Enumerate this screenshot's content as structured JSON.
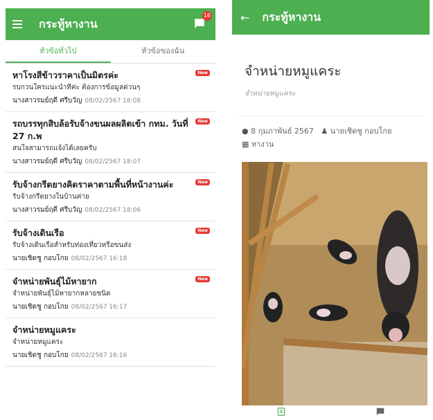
{
  "app": {
    "title": "กระทู้หางาน",
    "notification_count": "16"
  },
  "tabs": [
    {
      "label": "หัวข้อทั่วไป",
      "active": true
    },
    {
      "label": "หัวข้อของฉัน",
      "active": false
    }
  ],
  "posts": [
    {
      "title": "หาโรงสีข้าวราคาเป็นมิตรค่ะ",
      "subtitle": "รบกวนใครแนะนำทีค่ะ ต้องการข้อมูลด่วนๆ",
      "author": "นางสาวรมย์ฤดี ศรีบวัญ",
      "date": "08/02/2567 18:08",
      "new_badge": "New"
    },
    {
      "title": "รถบรรทุกสิบล้อรับจ้างขนผลผลิตเข้า กทม. วันที่ 27 ก.พ",
      "subtitle": "สนใจสามารถแจ้งได้เลยครับ",
      "author": "นางสาวรมย์ฤดี ศรีบวัญ",
      "date": "08/02/2567 18:07",
      "new_badge": "New"
    },
    {
      "title": "รับจ้างกรีดยางคิดราคาตามพื้นที่หน้างานค่ะ",
      "subtitle": "รับจ้างกรีดยางในบ้านค่าย",
      "author": "นางสาวรมย์ฤดี ศรีบวัญ",
      "date": "08/02/2567 18:06",
      "new_badge": "New"
    },
    {
      "title": "รับจ้างเดินเรือ",
      "subtitle": "รับจ้างเดินเรือสำหรับท่องเที่ยวหรือขนส่ง",
      "author": "นายเชิดชู กอบโกย",
      "date": "08/02/2567 16:18",
      "new_badge": "New"
    },
    {
      "title": "จำหน่ายพันธุ์ไม้หายาก",
      "subtitle": "จำหน่ายพันธุ์ไม้หายากหลายชนิด",
      "author": "นายเชิดชู กอบโกย",
      "date": "08/02/2567 16:17",
      "new_badge": "New"
    },
    {
      "title": "จำหน่ายหมูแคระ",
      "subtitle": "จำหน่ายหมูแคระ",
      "author": "นายเชิดชู กอบโกย",
      "date": "08/02/2567 16:16",
      "new_badge": ""
    }
  ],
  "detail": {
    "header_title": "กระทู้หางาน",
    "title": "จำหน่ายหมูแคระ",
    "subtitle": "จำหน่ายหมูแคระ",
    "date": "8 กุมภาพันธ์ 2567",
    "author": "นายเชิดชู กอบโกย",
    "category": "หางาน"
  },
  "icons": {
    "menu": "hamburger-icon",
    "chat": "chat-icon",
    "back": "arrow-left-icon",
    "clock": "clock-icon",
    "user": "user-icon",
    "category": "grid-icon",
    "article": "article-icon",
    "comment": "comment-icon"
  },
  "colors": {
    "primary": "#4caf50",
    "new_badge": "#e53935"
  }
}
